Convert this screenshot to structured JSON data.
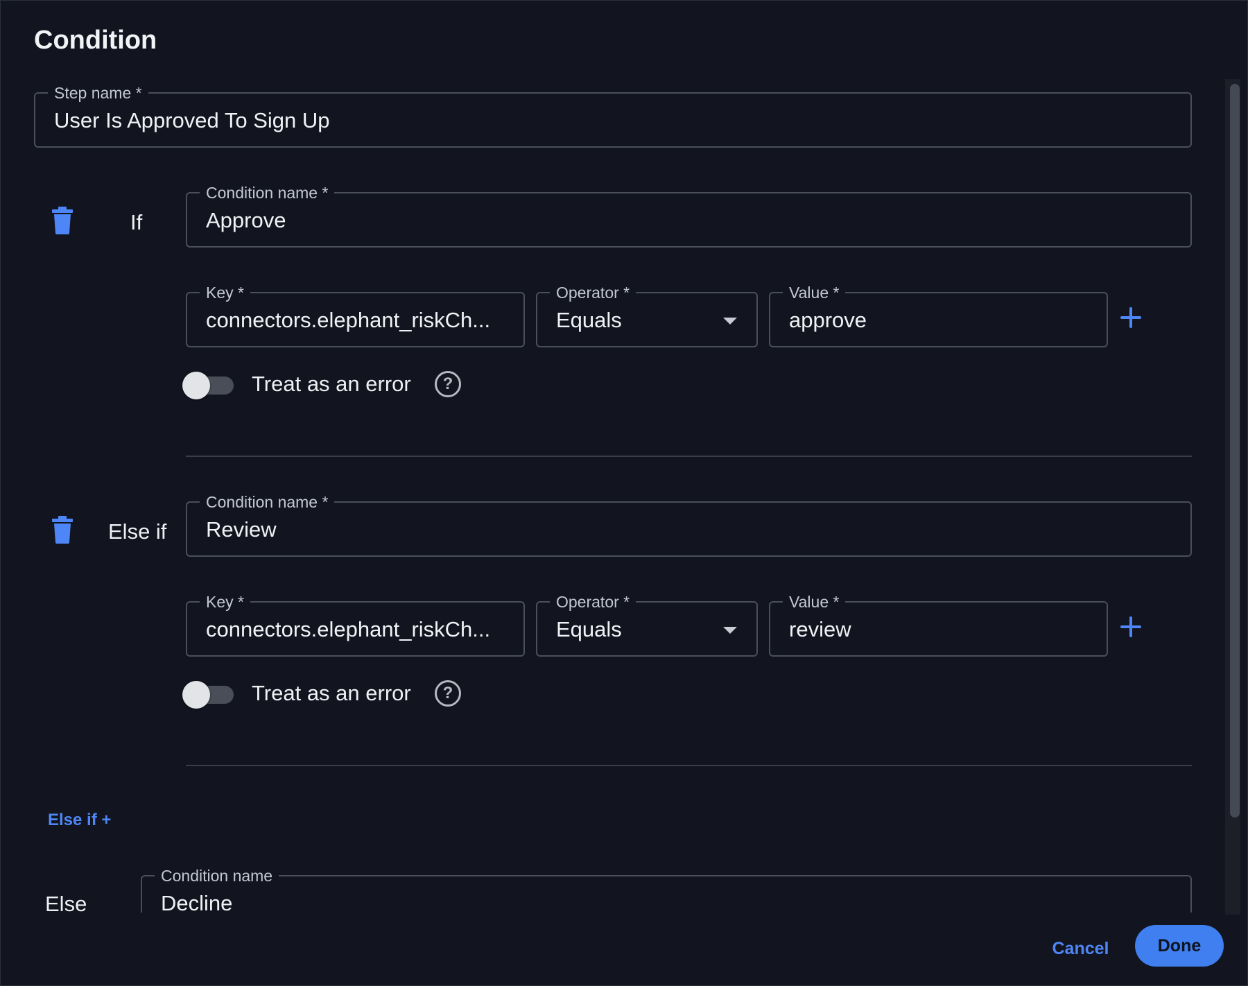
{
  "dialog": {
    "title": "Condition"
  },
  "step_name": {
    "label": "Step name *",
    "value": "User Is Approved To Sign Up"
  },
  "conditions": [
    {
      "branch": "If",
      "name_label": "Condition name *",
      "name": "Approve",
      "key_label": "Key *",
      "key": "connectors.elephant_riskCh...",
      "operator_label": "Operator *",
      "operator": "Equals",
      "value_label": "Value *",
      "value": "approve",
      "treat_as_error_label": "Treat as an error",
      "treat_as_error": false
    },
    {
      "branch": "Else if",
      "name_label": "Condition name *",
      "name": "Review",
      "key_label": "Key *",
      "key": "connectors.elephant_riskCh...",
      "operator_label": "Operator *",
      "operator": "Equals",
      "value_label": "Value *",
      "value": "review",
      "treat_as_error_label": "Treat as an error",
      "treat_as_error": false
    }
  ],
  "add_else_if": "Else if +",
  "else": {
    "branch": "Else",
    "name_label": "Condition name",
    "name": "Decline"
  },
  "footer": {
    "cancel": "Cancel",
    "done": "Done"
  },
  "icons": {
    "trash": "trash-icon",
    "plus": "plus-icon",
    "help": "question-circle-icon",
    "caret": "caret-down-icon"
  },
  "colors": {
    "accent": "#4f86f7",
    "background": "#12151f",
    "done_button": "#3f7fef"
  }
}
